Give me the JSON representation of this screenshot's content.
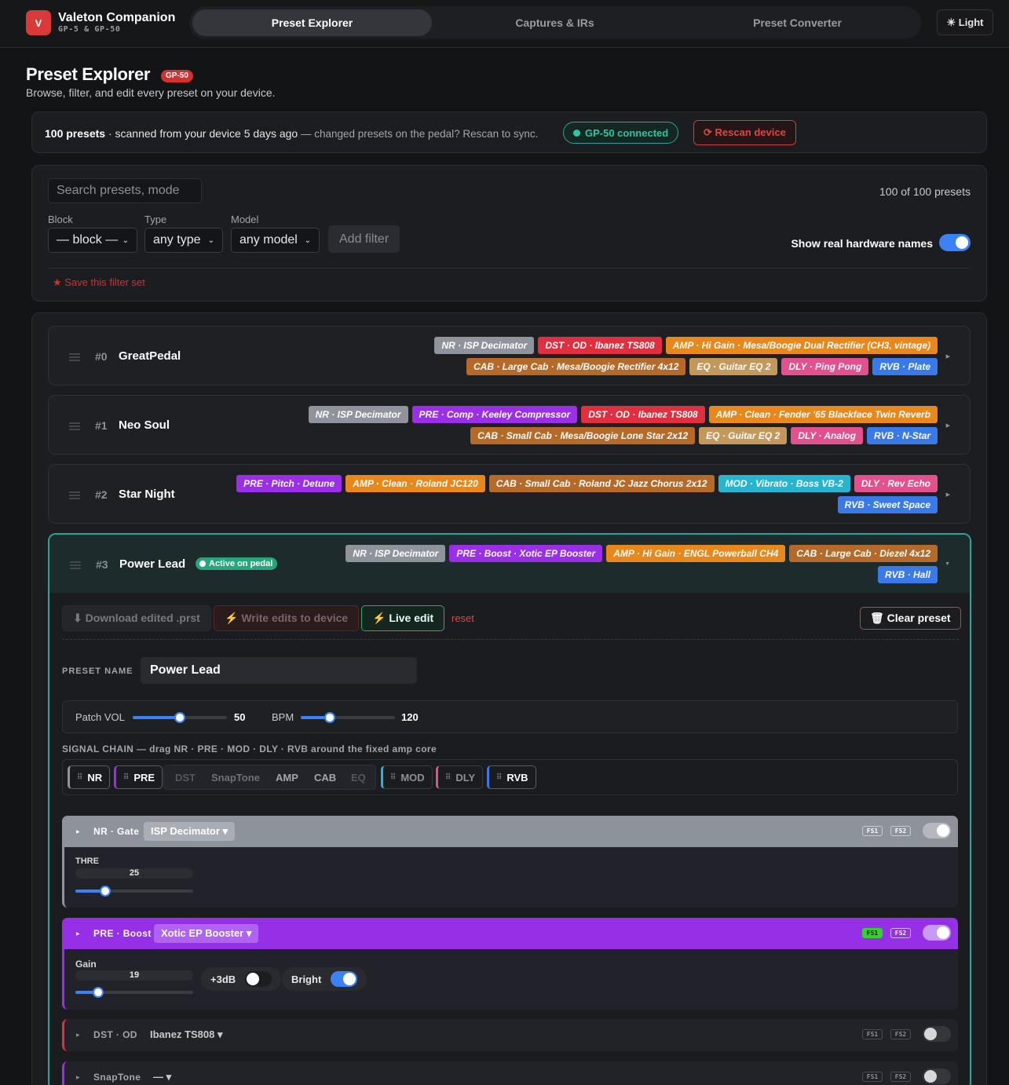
{
  "app": {
    "logo": "V",
    "title": "Valeton Companion",
    "subtitle": "GP-5 & GP-50"
  },
  "nav": {
    "tabs": [
      "Preset Explorer",
      "Captures & IRs",
      "Preset Converter"
    ],
    "theme_button": "☀ Light"
  },
  "page": {
    "title": "Preset Explorer",
    "device_badge": "GP-50",
    "subtitle": "Browse, filter, and edit every preset on your device."
  },
  "scan": {
    "count": "100 presets",
    "scanned": " · scanned from your device 5 days ago",
    "hint": " — changed presets on the pedal? Rescan to sync.",
    "connected": "GP-50 connected",
    "rescan": "⟳ Rescan device"
  },
  "filters": {
    "search_placeholder": "Search presets, mode",
    "count": "100 of 100 presets",
    "block_label": "Block",
    "block_value": "— block —",
    "type_label": "Type",
    "type_value": "any type",
    "model_label": "Model",
    "model_value": "any model",
    "add_filter": "Add filter",
    "hw_names_label": "Show real hardware names",
    "hw_names_on": true,
    "save_set": "★ Save this filter set"
  },
  "presets": [
    {
      "num": "#0",
      "name": "GreatPedal",
      "lines": [
        [
          {
            "t": "NR · ISP Decimator",
            "c": "nr"
          },
          {
            "t": "DST · OD · Ibanez TS808",
            "c": "dst"
          },
          {
            "t": "AMP · Hi Gain · Mesa/Boogie Dual Rectifier (CH3, vintage)",
            "c": "amp"
          }
        ],
        [
          {
            "t": "CAB · Large Cab · Mesa/Boogie Rectifier 4x12",
            "c": "cab"
          },
          {
            "t": "EQ · Guitar EQ 2",
            "c": "eq"
          },
          {
            "t": "DLY · Ping Pong",
            "c": "dly"
          },
          {
            "t": "RVB · Plate",
            "c": "rvb"
          }
        ]
      ]
    },
    {
      "num": "#1",
      "name": "Neo Soul",
      "lines": [
        [
          {
            "t": "NR · ISP Decimator",
            "c": "nr"
          },
          {
            "t": "PRE · Comp · Keeley Compressor",
            "c": "pre"
          },
          {
            "t": "DST · OD · Ibanez TS808",
            "c": "dst"
          },
          {
            "t": "AMP · Clean · Fender '65 Blackface Twin Reverb",
            "c": "amp"
          }
        ],
        [
          {
            "t": "CAB · Small Cab · Mesa/Boogie Lone Star 2x12",
            "c": "cab"
          },
          {
            "t": "EQ · Guitar EQ 2",
            "c": "eq"
          },
          {
            "t": "DLY · Analog",
            "c": "dly"
          },
          {
            "t": "RVB · N-Star",
            "c": "rvb"
          }
        ]
      ]
    },
    {
      "num": "#2",
      "name": "Star Night",
      "lines": [
        [
          {
            "t": "PRE · Pitch · Detune",
            "c": "pre"
          },
          {
            "t": "AMP · Clean · Roland JC120",
            "c": "amp"
          },
          {
            "t": "CAB · Small Cab · Roland JC Jazz Chorus 2x12",
            "c": "cab"
          },
          {
            "t": "MOD · Vibrato · Boss VB-2",
            "c": "mod"
          },
          {
            "t": "DLY · Rev Echo",
            "c": "dly"
          }
        ],
        [
          {
            "t": "RVB · Sweet Space",
            "c": "rvb"
          }
        ]
      ]
    },
    {
      "num": "#3",
      "name": "Power Lead",
      "active": "Active on pedal",
      "lines": [
        [
          {
            "t": "NR · ISP Decimator",
            "c": "nr"
          },
          {
            "t": "PRE · Boost · Xotic EP Booster",
            "c": "pre"
          },
          {
            "t": "AMP · Hi Gain · ENGL Powerball CH4",
            "c": "amp"
          },
          {
            "t": "CAB · Large Cab · Diezel 4x12",
            "c": "cab"
          }
        ],
        [
          {
            "t": "RVB · Hall",
            "c": "rvb"
          }
        ]
      ]
    }
  ],
  "editor": {
    "download": "⬇ Download edited .prst",
    "write": "⚡ Write edits to device",
    "live": "⚡ Live edit",
    "reset": "reset",
    "clear": "🗑 Clear preset",
    "name_label": "PRESET NAME",
    "name_value": "Power Lead",
    "patch_vol_label": "Patch VOL",
    "patch_vol": 50,
    "patch_vol_max": 100,
    "bpm_label": "BPM",
    "bpm": 120,
    "bpm_min": 40,
    "bpm_max": 300,
    "chain_label": "SIGNAL CHAIN — drag NR · PRE · MOD · DLY · RVB around the fixed amp core",
    "chain": {
      "nr": "NR",
      "pre": "PRE",
      "core": [
        "DST",
        "SnapTone",
        "AMP",
        "CAB",
        "EQ"
      ],
      "mod": "MOD",
      "dly": "DLY",
      "rvb": "RVB"
    }
  },
  "blocks": {
    "nr": {
      "cat": "NR · Gate",
      "model": "ISP Decimator ▾",
      "fs1": "FS1",
      "fs2": "FS2",
      "param": "THRE",
      "value": 25,
      "max": 100
    },
    "pre": {
      "cat": "PRE · Boost",
      "model": "Xotic EP Booster ▾",
      "fs1": "FS1",
      "fs2": "FS2",
      "param": "Gain",
      "value": 19,
      "max": 100,
      "sw1": "+3dB",
      "sw1_on": false,
      "sw2": "Bright",
      "sw2_on": true
    },
    "dst": {
      "cat": "DST · OD",
      "model": "Ibanez TS808 ▾",
      "fs1": "FS1",
      "fs2": "FS2"
    },
    "snap": {
      "cat": "SnapTone",
      "model": "— ▾",
      "fs1": "FS1",
      "fs2": "FS2"
    }
  },
  "colors": {
    "accent": "#3b82f6",
    "teal": "#2aa39a",
    "red": "#e0303f",
    "purple": "#9b2fe8",
    "gray": "#8f939b"
  }
}
